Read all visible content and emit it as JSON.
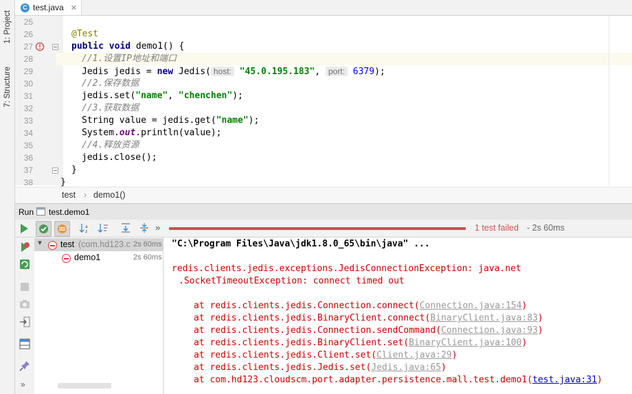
{
  "side_tabs": {
    "project": "1: Project",
    "structure": "7: Structure"
  },
  "editor": {
    "file_tab": "test.java",
    "file_icon_letter": "C",
    "lines": [
      {
        "n": "25"
      },
      {
        "n": "26"
      },
      {
        "n": "27"
      },
      {
        "n": "28"
      },
      {
        "n": "29"
      },
      {
        "n": "30"
      },
      {
        "n": "31"
      },
      {
        "n": "32"
      },
      {
        "n": "33"
      },
      {
        "n": "34"
      },
      {
        "n": "35"
      },
      {
        "n": "36"
      },
      {
        "n": "37"
      },
      {
        "n": "38"
      }
    ],
    "code": {
      "l26_annotation": "@Test",
      "l27_kw": "public void",
      "l27_rest": " demo1() {",
      "l28_comment": "//1.设置IP地址和端口",
      "l29_pre": "Jedis jedis = ",
      "l29_new": "new",
      "l29_mid": " Jedis(",
      "l29_hint_host": "host:",
      "l29_host": "\"45.0.195.183\"",
      "l29_comma": ", ",
      "l29_hint_port": "port:",
      "l29_port": "6379",
      "l29_end": ");",
      "l30_comment": "//2.保存数据",
      "l31_pre": "jedis.set(",
      "l31_s1": "\"name\"",
      "l31_mid": ", ",
      "l31_s2": "\"chenchen\"",
      "l31_end": ");",
      "l32_comment": "//3.获取数据",
      "l33_pre": "String value = jedis.get(",
      "l33_s1": "\"name\"",
      "l33_end": ");",
      "l34_pre": "System.",
      "l34_out": "out",
      "l34_end": ".println(value);",
      "l35_comment": "//4.释放资源",
      "l36_code": "jedis.close();",
      "l37_code": "}",
      "l38_code": "}"
    },
    "breadcrumb": [
      "test",
      "demo1()"
    ],
    "breadcrumb_sep": "›"
  },
  "run": {
    "label": "Run",
    "config": "test.demo1",
    "status": "1 test failed",
    "status_time": " - 2s 60ms",
    "more": "»",
    "tree": [
      {
        "label": "test",
        "pkg": "(com.hd123.c",
        "time": "2s 60ms"
      },
      {
        "label": "demo1",
        "time": "2s 60ms"
      }
    ],
    "console": {
      "cmd": "\"C:\\Program Files\\Java\\jdk1.8.0_65\\bin\\java\" ...",
      "ex1": "redis.clients.jedis.exceptions.JedisConnectionException: java.net",
      "ex2": ".SocketTimeoutException: connect timed out",
      "frames": [
        {
          "at": "at redis.clients.jedis.Connection.connect(",
          "link": "Connection.java:154",
          "end": ")"
        },
        {
          "at": "at redis.clients.jedis.BinaryClient.connect(",
          "link": "BinaryClient.java:83",
          "end": ")"
        },
        {
          "at": "at redis.clients.jedis.Connection.sendCommand(",
          "link": "Connection.java:93",
          "end": ")"
        },
        {
          "at": "at redis.clients.jedis.BinaryClient.set(",
          "link": "BinaryClient.java:100",
          "end": ")"
        },
        {
          "at": "at redis.clients.jedis.Client.set(",
          "link": "Client.java:29",
          "end": ")"
        },
        {
          "at": "at redis.clients.jedis.Jedis.set(",
          "link": "Jedis.java:65",
          "end": ")"
        },
        {
          "at": "at com.hd123.cloudscm.port.adapter.persistence.mall.test.demo1(",
          "link": "test.java:31",
          "end": ")"
        }
      ]
    }
  },
  "colors": {
    "fail": "#c75450",
    "pass": "#499c54",
    "accent": "#3c8fd9"
  }
}
